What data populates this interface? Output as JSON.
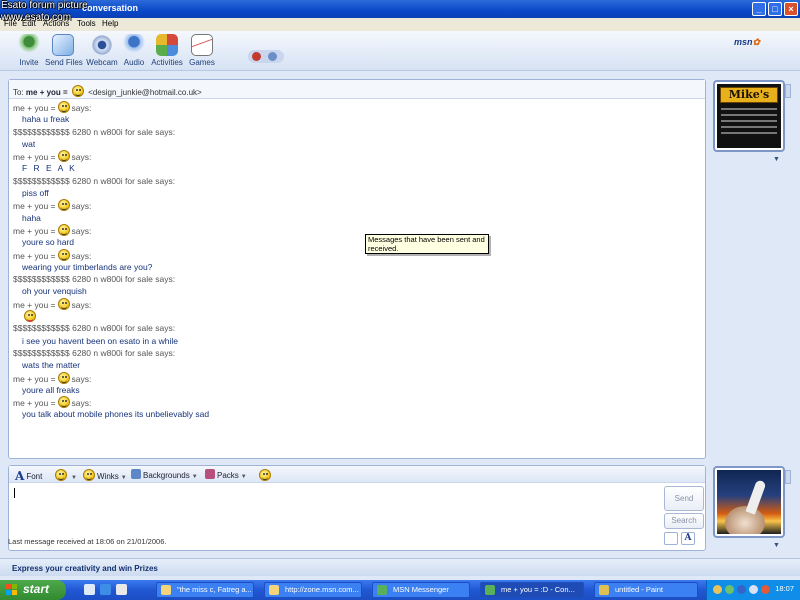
{
  "window": {
    "title": "conversation",
    "watermark_line1": "Esato forum picture",
    "watermark_line2": "www.esato.com"
  },
  "menu": [
    "File",
    "Edit",
    "Actions",
    "Tools",
    "Help"
  ],
  "toolbar": {
    "items": [
      {
        "label": "Invite",
        "icon": "invite-icon"
      },
      {
        "label": "Send Files",
        "icon": "send-files-icon"
      },
      {
        "label": "Webcam",
        "icon": "webcam-icon"
      },
      {
        "label": "Audio",
        "icon": "audio-icon"
      },
      {
        "label": "Activities",
        "icon": "activities-icon"
      },
      {
        "label": "Games",
        "icon": "games-icon"
      }
    ],
    "brand": "msn"
  },
  "to_bar": {
    "prefix": "To:",
    "name": "me + you =",
    "email": "<design_junkie@hotmail.co.uk>"
  },
  "messages": [
    {
      "type": "sender",
      "name": "me + you =",
      "smiley": true,
      "suffix": "says:"
    },
    {
      "type": "text",
      "text": "haha u freak"
    },
    {
      "type": "sender",
      "name": "$$$$$$$$$$$$ 6280 n w800i for sale",
      "smiley": false,
      "suffix": "says:"
    },
    {
      "type": "text",
      "text": "wat"
    },
    {
      "type": "sender",
      "name": "me + you =",
      "smiley": true,
      "suffix": "says:"
    },
    {
      "type": "text",
      "text": "F R E A K",
      "big": true
    },
    {
      "type": "sender",
      "name": "$$$$$$$$$$$$ 6280 n w800i for sale",
      "smiley": false,
      "suffix": "says:"
    },
    {
      "type": "text",
      "text": "piss off"
    },
    {
      "type": "sender",
      "name": "me + you =",
      "smiley": true,
      "suffix": "says:"
    },
    {
      "type": "text",
      "text": "haha"
    },
    {
      "type": "sender",
      "name": "me + you =",
      "smiley": true,
      "suffix": "says:"
    },
    {
      "type": "text",
      "text": "youre so hard"
    },
    {
      "type": "sender",
      "name": "me + you =",
      "smiley": true,
      "suffix": "says:"
    },
    {
      "type": "text",
      "text": "wearing your timberlands are you?"
    },
    {
      "type": "sender",
      "name": "$$$$$$$$$$$$ 6280 n w800i for sale",
      "smiley": false,
      "suffix": "says:"
    },
    {
      "type": "text",
      "text": "oh your venquish"
    },
    {
      "type": "sender",
      "name": "me + you =",
      "smiley": true,
      "suffix": "says:"
    },
    {
      "type": "emoticon",
      "icon": "tongue-smiley-icon"
    },
    {
      "type": "sender",
      "name": "$$$$$$$$$$$$ 6280 n w800i for sale",
      "smiley": false,
      "suffix": "says:"
    },
    {
      "type": "text",
      "text": "i see you havent been on esato in a while"
    },
    {
      "type": "sender",
      "name": "$$$$$$$$$$$$ 6280 n w800i for sale",
      "smiley": false,
      "suffix": "says:"
    },
    {
      "type": "text",
      "text": "wats the matter"
    },
    {
      "type": "sender",
      "name": "me + you =",
      "smiley": true,
      "suffix": "says:"
    },
    {
      "type": "text",
      "text": "youre all freaks"
    },
    {
      "type": "sender",
      "name": "me + you =",
      "smiley": true,
      "suffix": "says:"
    },
    {
      "type": "text",
      "text": "you talk about mobile phones its unbelievably sad"
    }
  ],
  "tooltip": "Messages that have been sent and received.",
  "format_bar": {
    "font": "Font",
    "winks": "Winks",
    "backgrounds": "Backgrounds",
    "packs": "Packs"
  },
  "input": {
    "value": "",
    "send_label": "Send",
    "search_label": "Search"
  },
  "status": "Last message received at 18:06 on 21/01/2006.",
  "promo": "Express your creativity and win Prizes",
  "display_picture_contact": {
    "logo_text": "Mike's"
  },
  "taskbar": {
    "start": "start",
    "tasks": [
      {
        "label": "\"the miss c, Fatreg a..."
      },
      {
        "label": "http://zone.msn.com..."
      },
      {
        "label": "MSN Messenger"
      },
      {
        "label": "me + you = :D - Con..."
      },
      {
        "label": "untitled - Paint"
      }
    ],
    "clock": "18:07"
  },
  "colors": {
    "titlebar": "#0a49c8",
    "message_text": "#16337a",
    "start_button": "#338a31",
    "taskbar": "#2157d3"
  }
}
